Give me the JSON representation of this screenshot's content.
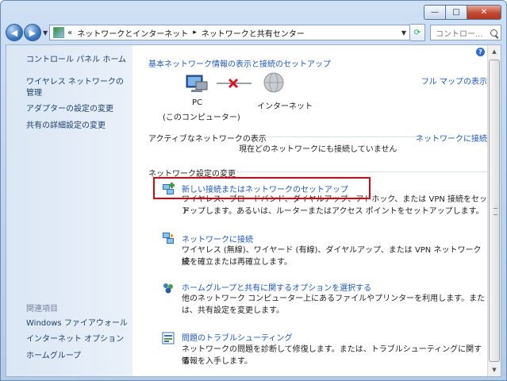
{
  "breadcrumb": {
    "root_glyph": "«",
    "item1": "ネットワークとインターネット",
    "separator": "▸",
    "item2": "ネットワークと共有センター"
  },
  "search": {
    "placeholder": "コントロー..."
  },
  "sidebar": {
    "items": [
      {
        "label": "コントロール パネル ホーム"
      },
      {
        "label": "ワイヤレス ネットワークの管理"
      },
      {
        "label": "アダプターの設定の変更"
      },
      {
        "label": "共有の詳細設定の変更"
      }
    ],
    "related_heading": "関連項目",
    "related": [
      {
        "label": "Windows ファイアウォール"
      },
      {
        "label": "インターネット オプション"
      },
      {
        "label": "ホームグループ"
      }
    ]
  },
  "main": {
    "help_glyph": "?",
    "map_title": "基本ネットワーク情報の表示と接続のセットアップ",
    "full_map_link": "フル マップの表示",
    "map_pc_label": "PC",
    "map_pc_sub": "(このコンピューター)",
    "map_internet_label": "インターネット",
    "active_header": "アクティブなネットワークの表示",
    "connect_link": "ネットワークに接続",
    "active_status": "現在どのネットワークにも接続していません",
    "settings_header": "ネットワーク設定の変更",
    "tasks": [
      {
        "title": "新しい接続またはネットワークのセットアップ",
        "desc1": "ワイヤレス、ブロードバンド、ダイヤルアップ、アドホック、または VPN 接続をセット",
        "desc2": "アップします。あるいは、ルーターまたはアクセス ポイントをセットアップします。",
        "icon": "network-setup-icon"
      },
      {
        "title": "ネットワークに接続",
        "desc1": "ワイヤレス (無線)、ワイヤード (有線)、ダイヤルアップ、または VPN ネットワーク接",
        "desc2": "続を確立または再確立します。",
        "icon": "connect-network-icon"
      },
      {
        "title": "ホームグループと共有に関するオプションを選択する",
        "desc1": "他のネットワーク コンピューター上にあるファイルやプリンターを利用します。また",
        "desc2": "は、共有設定を変更します。",
        "icon": "homegroup-icon"
      },
      {
        "title": "問題のトラブルシューティング",
        "desc1": "ネットワークの問題を診断して修復します。または、トラブルシューティングに関する",
        "desc2": "情報を入手します。",
        "icon": "troubleshoot-icon"
      }
    ]
  },
  "colors": {
    "link": "#1e57b5",
    "highlight": "#e00012",
    "sidebar_bg": "#dbe7f5"
  }
}
